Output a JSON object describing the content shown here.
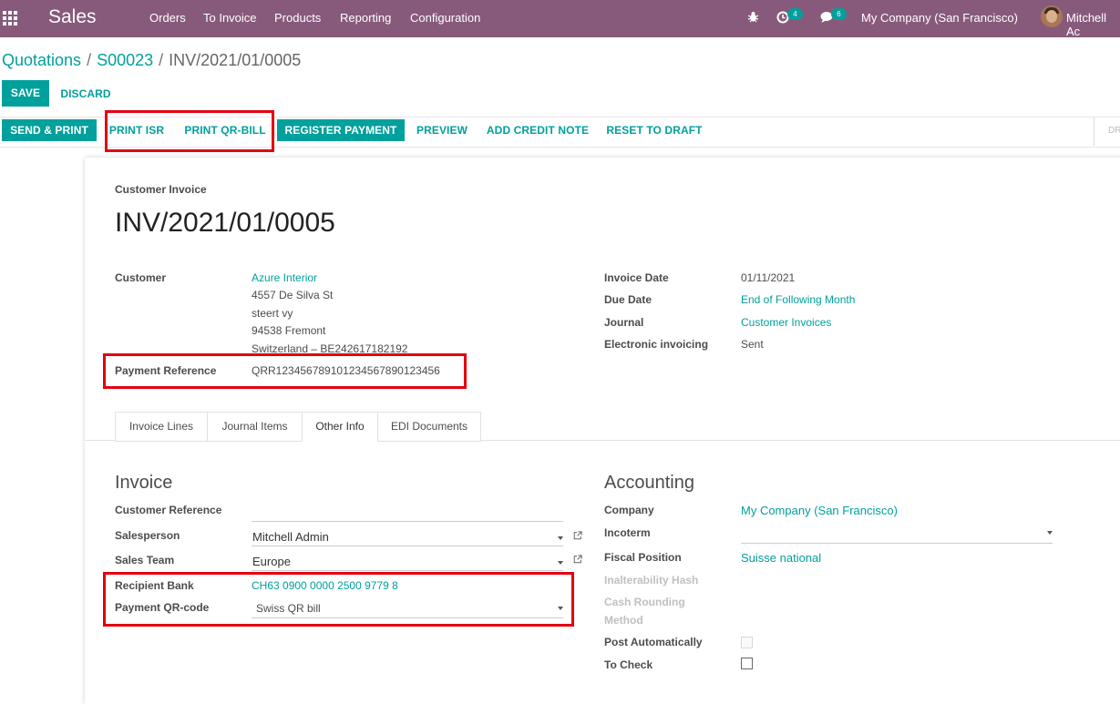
{
  "navbar": {
    "app_name": "Sales",
    "menu": [
      "Orders",
      "To Invoice",
      "Products",
      "Reporting",
      "Configuration"
    ],
    "activity_count": "4",
    "message_count": "6",
    "company": "My Company (San Francisco)",
    "user": "Mitchell Ac"
  },
  "breadcrumb": {
    "items": [
      "Quotations",
      "S00023"
    ],
    "current": "INV/2021/01/0005"
  },
  "form_buttons": {
    "save": "SAVE",
    "discard": "DISCARD"
  },
  "status_buttons": {
    "send_print": "SEND & PRINT",
    "print_isr": "PRINT ISR",
    "print_qr_bill": "PRINT QR-BILL",
    "register_payment": "REGISTER PAYMENT",
    "preview": "PREVIEW",
    "add_credit_note": "ADD CREDIT NOTE",
    "reset_to_draft": "RESET TO DRAFT",
    "status_right": "DR"
  },
  "invoice": {
    "type_label": "Customer Invoice",
    "number": "INV/2021/01/0005",
    "customer_label": "Customer",
    "customer_name": "Azure Interior",
    "address": [
      "4557 De Silva St",
      "steert vy",
      "94538 Fremont",
      "Switzerland – BE242617182192"
    ],
    "payment_ref_label": "Payment Reference",
    "payment_ref": "QRR12345678910123456789012345​6",
    "invoice_date_label": "Invoice Date",
    "invoice_date": "01/11/2021",
    "due_date_label": "Due Date",
    "due_date": "End of Following Month",
    "journal_label": "Journal",
    "journal": "Customer Invoices",
    "einvoicing_label": "Electronic invoicing",
    "einvoicing": "Sent"
  },
  "tabs": [
    "Invoice Lines",
    "Journal Items",
    "Other Info",
    "EDI Documents"
  ],
  "other_info": {
    "invoice_title": "Invoice",
    "customer_reference_label": "Customer Reference",
    "customer_reference": "",
    "salesperson_label": "Salesperson",
    "salesperson": "Mitchell Admin",
    "sales_team_label": "Sales Team",
    "sales_team": "Europe",
    "recipient_bank_label": "Recipient Bank",
    "recipient_bank": "CH63 0900 0000 2500 9779 8",
    "payment_qr_label": "Payment QR-code",
    "payment_qr": "Swiss QR bill",
    "accounting_title": "Accounting",
    "company_label": "Company",
    "company": "My Company (San Francisco)",
    "incoterm_label": "Incoterm",
    "incoterm": "",
    "fiscal_position_label": "Fiscal Position",
    "fiscal_position": "Suisse national",
    "inalterability_label": "Inalterability Hash",
    "cash_rounding_label_1": "Cash Rounding",
    "cash_rounding_label_2": "Method",
    "post_auto_label": "Post Automatically",
    "to_check_label": "To Check"
  },
  "colors": {
    "nav": "#875a7b",
    "primary": "#00a09d",
    "highlight": "#e3000f"
  }
}
